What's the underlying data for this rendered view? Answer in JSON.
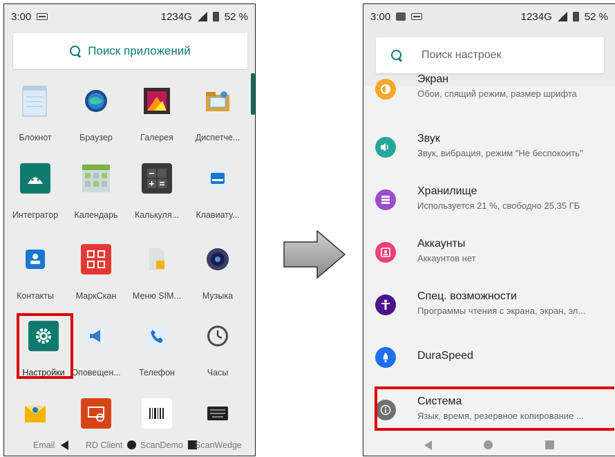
{
  "left_screen": {
    "status": {
      "time": "3:00",
      "network": "1234G",
      "battery": "52 %"
    },
    "search_label": "Поиск приложений",
    "apps": [
      {
        "label": "Блокнот",
        "icon": "notepad-icon"
      },
      {
        "label": "Браузер",
        "icon": "browser-icon"
      },
      {
        "label": "Галерея",
        "icon": "gallery-icon"
      },
      {
        "label": "Диспетче...",
        "icon": "file-manager-icon"
      },
      {
        "label": "Интегратор",
        "icon": "android-icon"
      },
      {
        "label": "Календарь",
        "icon": "calendar-icon"
      },
      {
        "label": "Калькуля...",
        "icon": "calculator-icon"
      },
      {
        "label": "Клавиату...",
        "icon": "keyboard-icon"
      },
      {
        "label": "Контакты",
        "icon": "contacts-icon"
      },
      {
        "label": "МаркСкан",
        "icon": "qr-scan-icon"
      },
      {
        "label": "Меню SIM...",
        "icon": "sim-menu-icon"
      },
      {
        "label": "Музыка",
        "icon": "music-icon"
      },
      {
        "label": "Настройки",
        "icon": "gear-icon"
      },
      {
        "label": "Оповещен...",
        "icon": "megaphone-icon"
      },
      {
        "label": "Телефон",
        "icon": "phone-icon"
      },
      {
        "label": "Часы",
        "icon": "clock-icon"
      }
    ],
    "bottom_row": [
      "Email",
      "RD Client",
      "ScanDemo",
      "ScanWedge"
    ]
  },
  "right_screen": {
    "status": {
      "time": "3:00",
      "network": "1234G",
      "battery": "52 %"
    },
    "search_placeholder": "Поиск настроек",
    "settings": [
      {
        "title": "Экран",
        "subtitle": "Обои, спящий режим, размер шрифта",
        "color": "#f9a825",
        "icon": "display-icon"
      },
      {
        "title": "Звук",
        "subtitle": "Звук, вибрация, режим \"Не беспокоить\"",
        "color": "#26a69a",
        "icon": "volume-icon"
      },
      {
        "title": "Хранилище",
        "subtitle": "Используется 21 %, свободно 25,35 ГБ",
        "color": "#9c4dcc",
        "icon": "storage-icon"
      },
      {
        "title": "Аккаунты",
        "subtitle": "Аккаунтов нет",
        "color": "#ec407a",
        "icon": "account-icon"
      },
      {
        "title": "Спец. возможности",
        "subtitle": "Программы чтения с экрана, экран, эл...",
        "color": "#4a148c",
        "icon": "accessibility-icon"
      },
      {
        "title": "DuraSpeed",
        "subtitle": "",
        "color": "#1e6ff0",
        "icon": "rocket-icon"
      },
      {
        "title": "Система",
        "subtitle": "Язык, время, резервное копирование ...",
        "color": "#707070",
        "icon": "info-icon"
      }
    ]
  }
}
